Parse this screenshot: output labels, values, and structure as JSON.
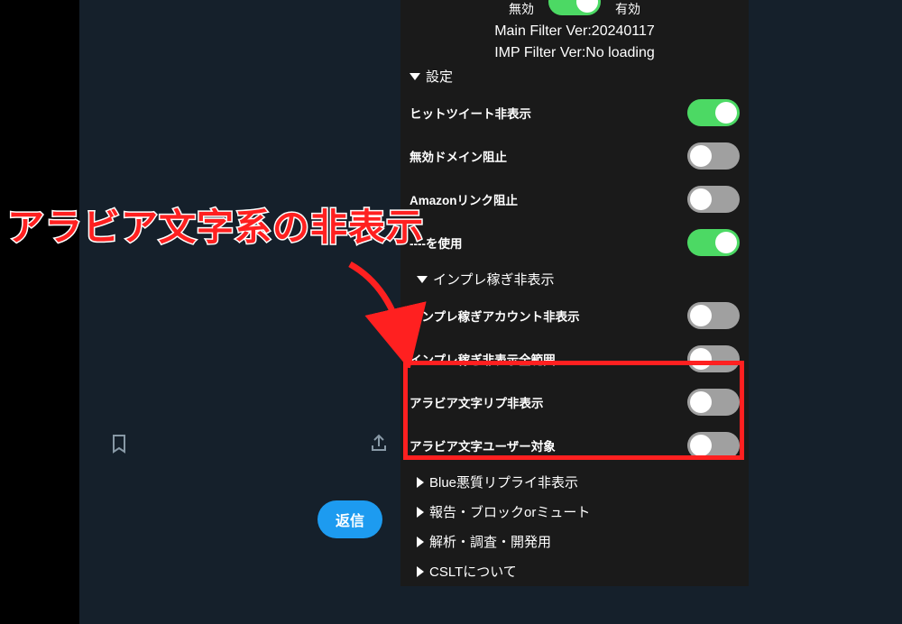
{
  "annotation": {
    "title": "アラビア文字系の非表示"
  },
  "underlay": {
    "reply_button": "返信"
  },
  "panel": {
    "top": {
      "left_label": "無効",
      "right_label": "有効",
      "master_on": true
    },
    "version": {
      "main": "Main Filter Ver:20240117",
      "imp": "IMP Filter Ver:No loading"
    },
    "section_settings": "設定",
    "rows_settings": [
      {
        "label": "ヒットツイート非表示",
        "on": true
      },
      {
        "label": "無効ドメイン阻止",
        "on": false
      },
      {
        "label": "Amazonリンク阻止",
        "on": false
      },
      {
        "label": "----を使用",
        "on": true
      }
    ],
    "section_impress": "インプレ稼ぎ非表示",
    "rows_impress": [
      {
        "label": "インプレ稼ぎアカウント非表示",
        "on": false
      },
      {
        "label": "インプレ稼ぎ非表示全範囲",
        "on": false
      },
      {
        "label": "アラビア文字リプ非表示",
        "on": false
      },
      {
        "label": "アラビア文字ユーザー対象",
        "on": false
      }
    ],
    "collapsed_sections": [
      "Blue悪質リプライ非表示",
      "報告・ブロックorミュート",
      "解析・調査・開発用",
      "CSLTについて"
    ]
  }
}
